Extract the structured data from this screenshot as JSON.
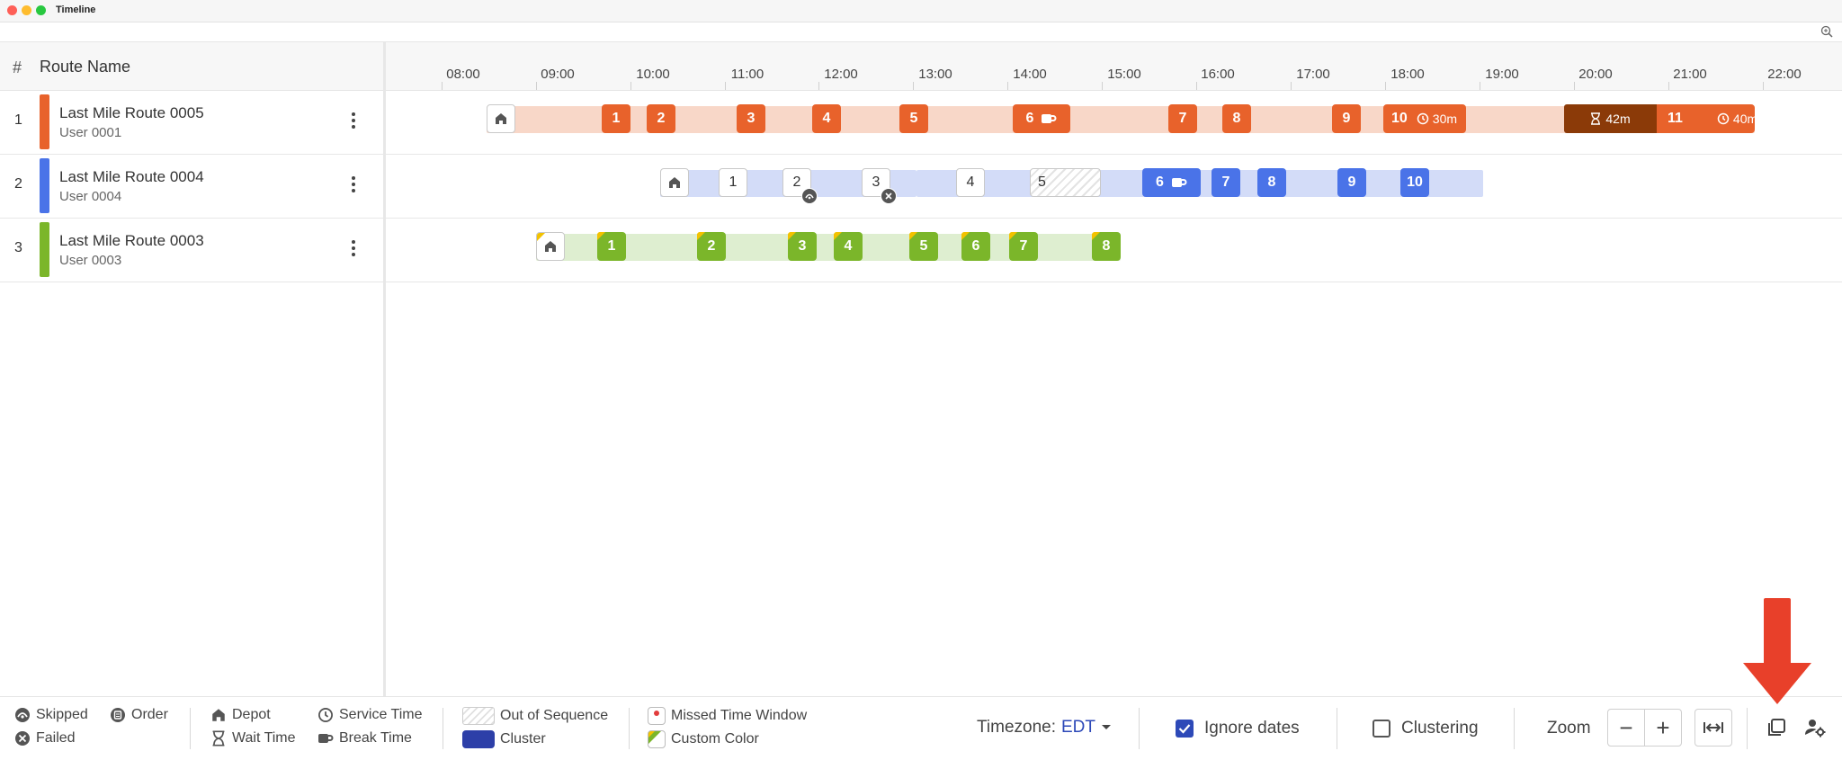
{
  "window": {
    "title": "Timeline"
  },
  "left_panel": {
    "header": {
      "hash": "#",
      "title": "Route Name"
    },
    "routes": [
      {
        "num": "1",
        "name": "Last Mile Route 0005",
        "user": "User 0001",
        "color": "#e8622b"
      },
      {
        "num": "2",
        "name": "Last Mile Route 0004",
        "user": "User 0004",
        "color": "#4a73e8"
      },
      {
        "num": "3",
        "name": "Last Mile Route 0003",
        "user": "User 0003",
        "color": "#7bb62a"
      }
    ]
  },
  "timeline": {
    "hours": [
      "08:00",
      "09:00",
      "10:00",
      "11:00",
      "12:00",
      "13:00",
      "14:00",
      "15:00",
      "16:00",
      "17:00",
      "18:00",
      "19:00",
      "20:00",
      "21:00",
      "22:00"
    ],
    "route1": {
      "stops": [
        "1",
        "2",
        "3",
        "4",
        "5",
        "6",
        "7",
        "8",
        "9",
        "10",
        "11"
      ],
      "service_10": "30m",
      "wait": "42m",
      "service_11": "40m"
    },
    "route2": {
      "stops": [
        "1",
        "2",
        "3",
        "4",
        "5",
        "6",
        "7",
        "8",
        "9",
        "10"
      ]
    },
    "route3": {
      "stops": [
        "1",
        "2",
        "3",
        "4",
        "5",
        "6",
        "7",
        "8"
      ]
    }
  },
  "legend": {
    "skipped": "Skipped",
    "order": "Order",
    "failed": "Failed",
    "depot": "Depot",
    "service_time": "Service Time",
    "wait_time": "Wait Time",
    "break_time": "Break Time",
    "out_of_sequence": "Out of Sequence",
    "cluster": "Cluster",
    "missed_time_window": "Missed Time Window",
    "custom_color": "Custom Color"
  },
  "controls": {
    "timezone_label": "Timezone:",
    "timezone_value": "EDT",
    "ignore_dates": "Ignore dates",
    "ignore_dates_checked": true,
    "clustering": "Clustering",
    "clustering_checked": false,
    "zoom_label": "Zoom",
    "zoom_out": "−",
    "zoom_in": "+"
  },
  "colors": {
    "orange": "#e8622b",
    "orange_light": "#f8d7c8",
    "blue": "#4a73e8",
    "blue_light": "#d3dcf8",
    "green": "#7bb62a",
    "green_light": "#deeed0",
    "accent": "#2d49b8"
  }
}
